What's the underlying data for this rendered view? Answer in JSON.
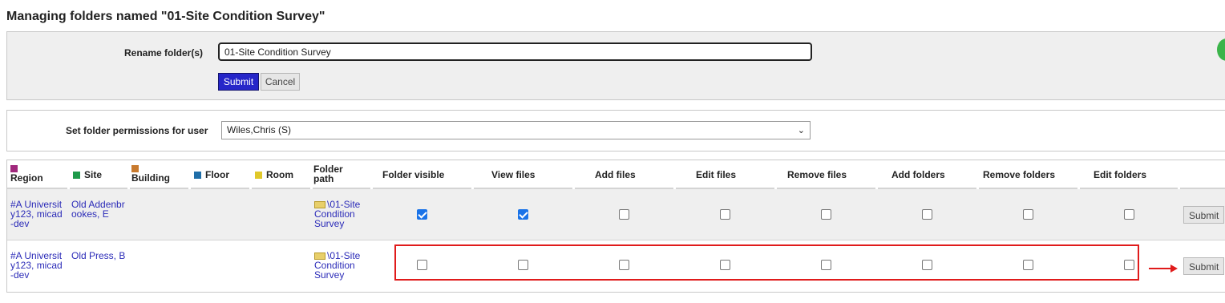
{
  "page": {
    "title": "Managing folders named \"01-Site Condition Survey\""
  },
  "rename": {
    "label": "Rename folder(s)",
    "value": "01-Site Condition Survey",
    "submit_label": "Submit",
    "cancel_label": "Cancel"
  },
  "permissions": {
    "label": "Set folder permissions for user",
    "selected_user": "Wiles,Chris (S)"
  },
  "table": {
    "columns": [
      {
        "label": "Region",
        "swatch": "#a0287c"
      },
      {
        "label": "Site",
        "swatch": "#1e9a4a"
      },
      {
        "label": "Building",
        "swatch": "#c87a2e"
      },
      {
        "label": "Floor",
        "swatch": "#1f6ea8"
      },
      {
        "label": "Room",
        "swatch": "#e0c82a"
      },
      {
        "label": "Folder path"
      },
      {
        "label": "Folder visible"
      },
      {
        "label": "View files"
      },
      {
        "label": "Add files"
      },
      {
        "label": "Edit files"
      },
      {
        "label": "Remove files"
      },
      {
        "label": "Add folders"
      },
      {
        "label": "Remove folders"
      },
      {
        "label": "Edit folders"
      }
    ],
    "rows": [
      {
        "region": "#A University123, micad-dev",
        "site": "Old Addenbrookes, E",
        "folder_path": "\\01-Site Condition Survey",
        "folder_visible": true,
        "view_files": true,
        "add_files": false,
        "edit_files": false,
        "remove_files": false,
        "add_folders": false,
        "remove_folders": false,
        "edit_folders": false,
        "submit_label": "Submit"
      },
      {
        "region": "#A University123, micad-dev",
        "site": "Old Press, B",
        "folder_path": "\\01-Site Condition Survey",
        "folder_visible": false,
        "view_files": false,
        "add_files": false,
        "edit_files": false,
        "remove_files": false,
        "add_folders": false,
        "remove_folders": false,
        "edit_folders": false,
        "submit_label": "Submit"
      }
    ]
  },
  "icons": {
    "folder": "folder-icon",
    "dropdown": "chevron-down-icon"
  },
  "colors": {
    "primary_button": "#2626c9",
    "link": "#2b2bb8",
    "checkbox_checked": "#1a73e8",
    "annotation": "#e01b1b"
  }
}
